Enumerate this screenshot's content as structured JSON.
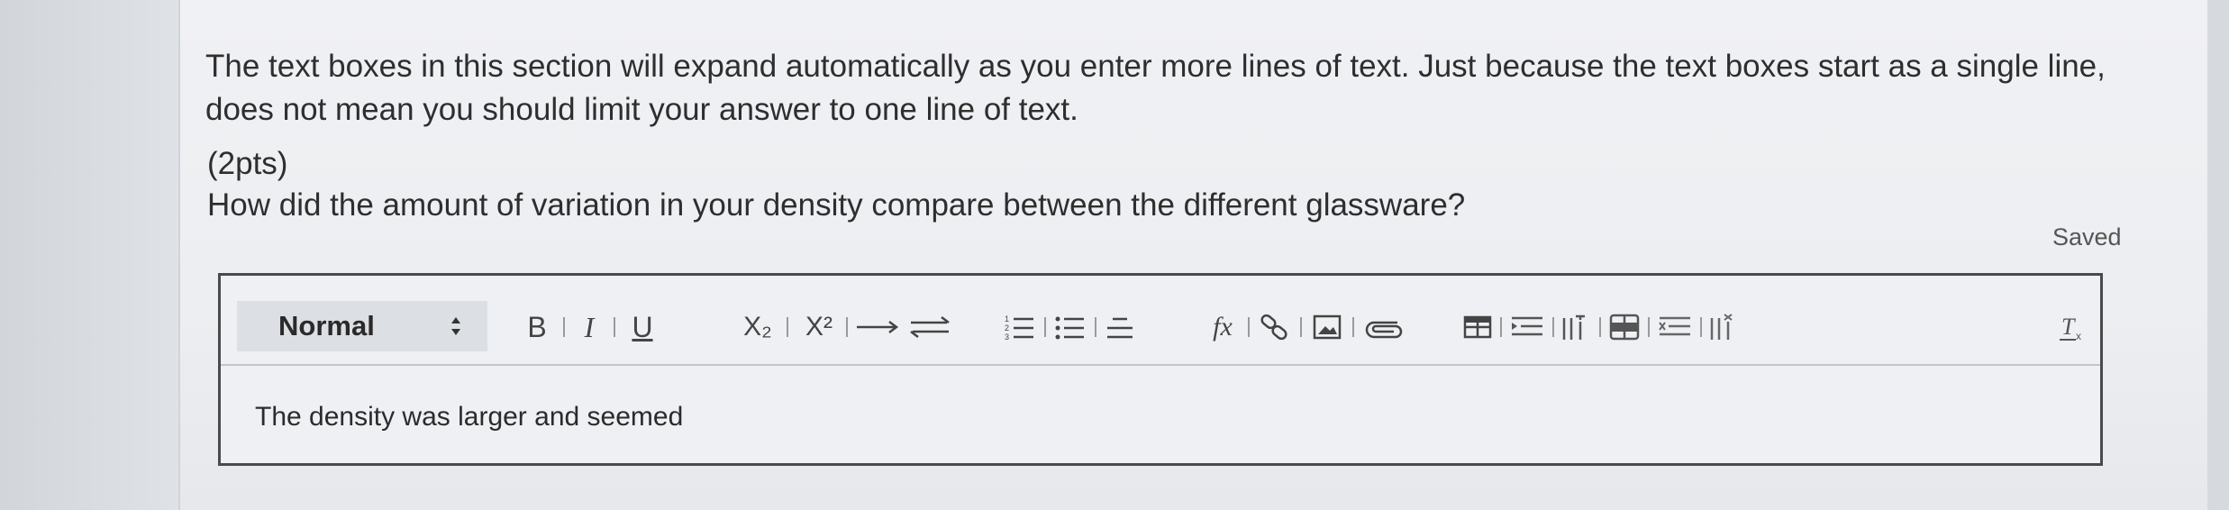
{
  "instructions": "The text boxes in this section will expand automatically as you enter more lines of text. Just because the text boxes start as a single line, does not mean you should limit your answer to one line of text.",
  "question": {
    "points": "(2pts)",
    "text": "How did the amount of variation in your density compare between the different glassware?"
  },
  "status": {
    "saved": "Saved"
  },
  "editor": {
    "format_select": "Normal",
    "answer": "The density was larger and seemed",
    "buttons": {
      "bold": "B",
      "italic": "I",
      "underline": "U",
      "subscript": "X₂",
      "superscript": "X²",
      "formula": "fx"
    },
    "toolbar_icons": [
      "chevron-updown-icon",
      "bold-icon",
      "italic-icon",
      "underline-icon",
      "subscript-icon",
      "superscript-icon",
      "arrow-right-icon",
      "equilibrium-arrows-icon",
      "numbered-list-icon",
      "bulleted-list-icon",
      "align-icon",
      "formula-icon",
      "link-icon",
      "image-icon",
      "attachment-icon",
      "table-icon",
      "insert-row-icon",
      "insert-column-icon",
      "table-row-delete-icon",
      "delete-row-icon",
      "delete-column-icon",
      "clear-formatting-icon"
    ]
  },
  "colors": {
    "text": "#2e2e2e",
    "border": "#4a4a4a",
    "select_bg": "#dcdfe3"
  }
}
